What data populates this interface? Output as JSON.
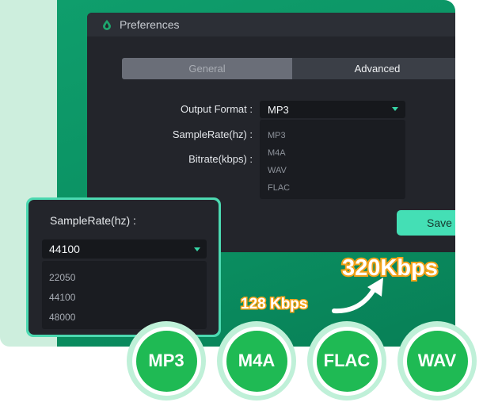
{
  "window": {
    "title": "Preferences",
    "tabs": [
      {
        "label": "General",
        "active": false
      },
      {
        "label": "Advanced",
        "active": true
      }
    ],
    "fields": {
      "output_format_label": "Output Format :",
      "sample_rate_label": "SampleRate(hz) :",
      "bitrate_label": "Bitrate(kbps) :"
    },
    "output_format": {
      "selected": "MP3",
      "options": [
        "MP3",
        "M4A",
        "WAV",
        "FLAC"
      ]
    },
    "save_label": "Save"
  },
  "samplerate_card": {
    "label": "SampleRate(hz) :",
    "selected": "44100",
    "options": [
      "22050",
      "44100",
      "48000"
    ]
  },
  "bitrate_callout": {
    "from": "128 Kbps",
    "to": "320Kbps"
  },
  "formats": [
    "MP3",
    "M4A",
    "FLAC",
    "WAV"
  ],
  "colors": {
    "accent_green": "#1fba54",
    "teal": "#44dfb5",
    "orange_outline": "#f2a21a",
    "background_green": "#0a8f61"
  },
  "icons": {
    "app_logo": "drop-logo-icon",
    "dropdown_caret": "caret-down-icon",
    "arrow": "curved-arrow-icon"
  }
}
